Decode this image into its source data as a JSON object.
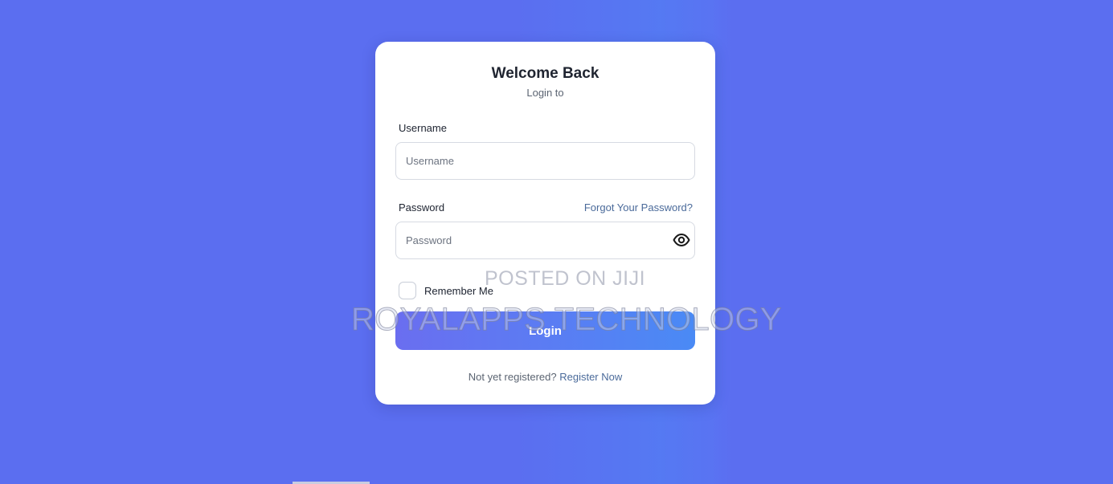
{
  "login": {
    "title": "Welcome Back",
    "subtitle": "Login to",
    "username_label": "Username",
    "username_placeholder": "Username",
    "password_label": "Password",
    "password_placeholder": "Password",
    "forgot_link": "Forgot Your Password?",
    "remember_label": "Remember Me",
    "remember_checked": false,
    "login_button": "Login",
    "register_prompt": "Not yet registered?",
    "register_link": "Register Now"
  },
  "watermarks": {
    "line1": "POSTED ON JIJI",
    "line2": "ROYALAPPS TECHNOLOGY"
  },
  "icons": {
    "password_toggle": "eye-icon"
  },
  "colors": {
    "background": "#5b6ef0",
    "card": "#ffffff",
    "link": "#4a6a9a",
    "button_start": "#6a6ef0",
    "button_end": "#4a8af5"
  }
}
